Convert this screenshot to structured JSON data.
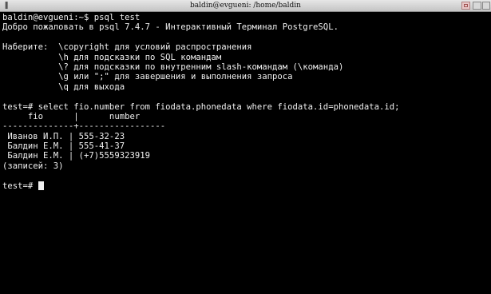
{
  "window": {
    "title": "baldin@evgueni: /home/baldin"
  },
  "titlebar_icons": {
    "menu": "window-menu-icon",
    "maximize": "maximize-icon",
    "minimize": "minimize-icon",
    "close": "close-icon"
  },
  "terminal": {
    "lines": [
      "baldin@evgueni:~$ psql test",
      "Добро пожаловать в psql 7.4.7 - Интерактивный Терминал PostgreSQL.",
      "",
      "Наберите:  \\copyright для условий распространения",
      "           \\h для подсказки по SQL командам",
      "           \\? для подсказки по внутренним slash-командам (\\команда)",
      "           \\g или \";\" для завершения и выполнения запроса",
      "           \\q для выхода",
      "",
      "test=# select fio.number from fiodata.phonedata where fiodata.id=phonedata.id;",
      "     fio      |      number",
      "--------------+-----------------",
      " Иванов И.П. | 555-32-23",
      " Балдин Е.М. | 555-41-37",
      " Балдин Е.М. | (+7)5559323919",
      "(записей: 3)",
      "",
      "test=# "
    ]
  }
}
